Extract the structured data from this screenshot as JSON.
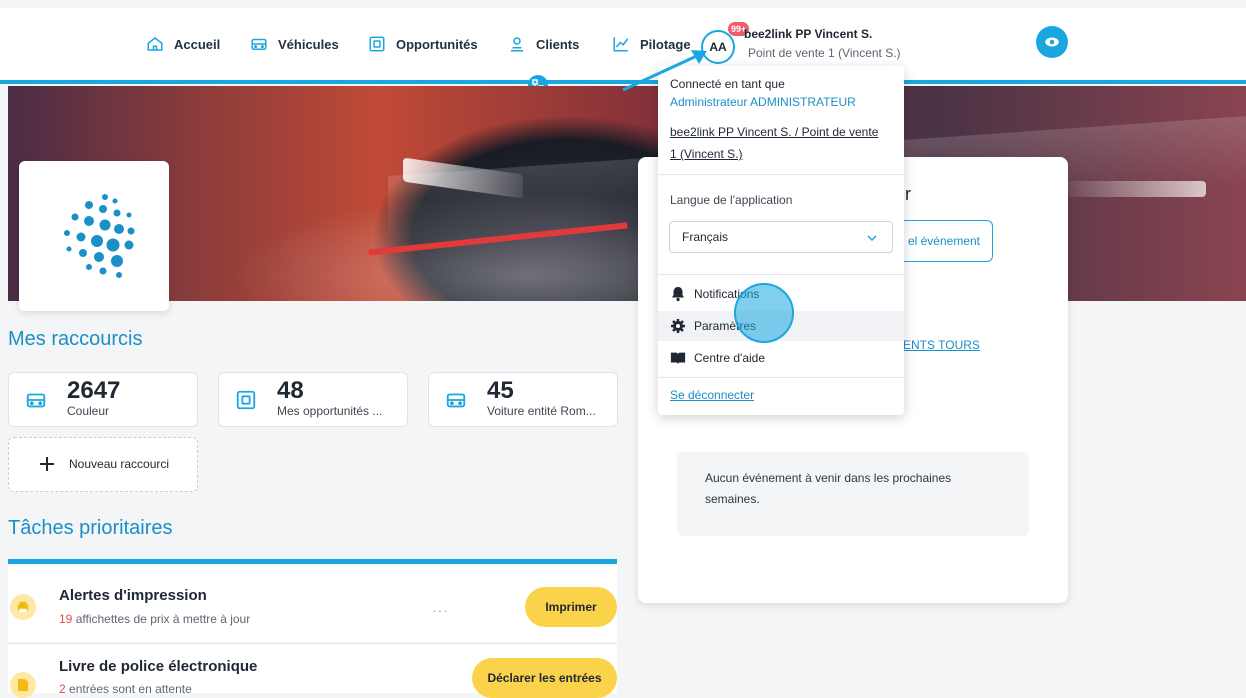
{
  "nav": {
    "items": [
      {
        "label": "Accueil",
        "icon": "home-icon"
      },
      {
        "label": "Véhicules",
        "icon": "car-icon"
      },
      {
        "label": "Opportunités",
        "icon": "opportunity-icon"
      },
      {
        "label": "Clients",
        "icon": "user-icon"
      },
      {
        "label": "Pilotage",
        "icon": "chart-icon"
      }
    ],
    "avatar_initials": "AA",
    "notif_badge": "99+",
    "user_name": "bee2link PP Vincent S.",
    "user_sub": "Point de vente 1 (Vincent S.)"
  },
  "dropdown": {
    "connected_as": "Connecté en tant que",
    "role": "Administrateur ADMINISTRATEUR",
    "org_line1": "bee2link PP Vincent S. / Point de vente",
    "org_line2": "1 (Vincent S.)",
    "lang_label": "Langue de l'application",
    "lang_value": "Français",
    "items": [
      "Notifications",
      "Paramètres",
      "Centre d'aide"
    ],
    "logout": "Se déconnecter"
  },
  "shortcuts": {
    "title": "Mes raccourcis",
    "items": [
      {
        "value": "2647",
        "label": "Couleur"
      },
      {
        "value": "48",
        "label": "Mes opportunités ..."
      },
      {
        "value": "45",
        "label": "Voiture entité Rom..."
      }
    ],
    "new_label": "Nouveau raccourci"
  },
  "tasks": {
    "title": "Tâches prioritaires",
    "items": [
      {
        "title": "Alertes d'impression",
        "count": "19",
        "sub": " affichettes de prix à mettre à jour",
        "action": "Imprimer"
      },
      {
        "title": "Livre de police électronique",
        "count": "2",
        "sub": " entrées sont en attente",
        "action": "Déclarer les entrées"
      }
    ]
  },
  "events": {
    "title_partial": "r",
    "new_event": "el événement",
    "tours_link": "MENTS TOURS",
    "empty": "Aucun événement à venir dans les prochaines semaines."
  },
  "colors": {
    "accent": "#1aa7e0",
    "button_yellow": "#fbd34b",
    "badge_red": "#f35b6d"
  }
}
